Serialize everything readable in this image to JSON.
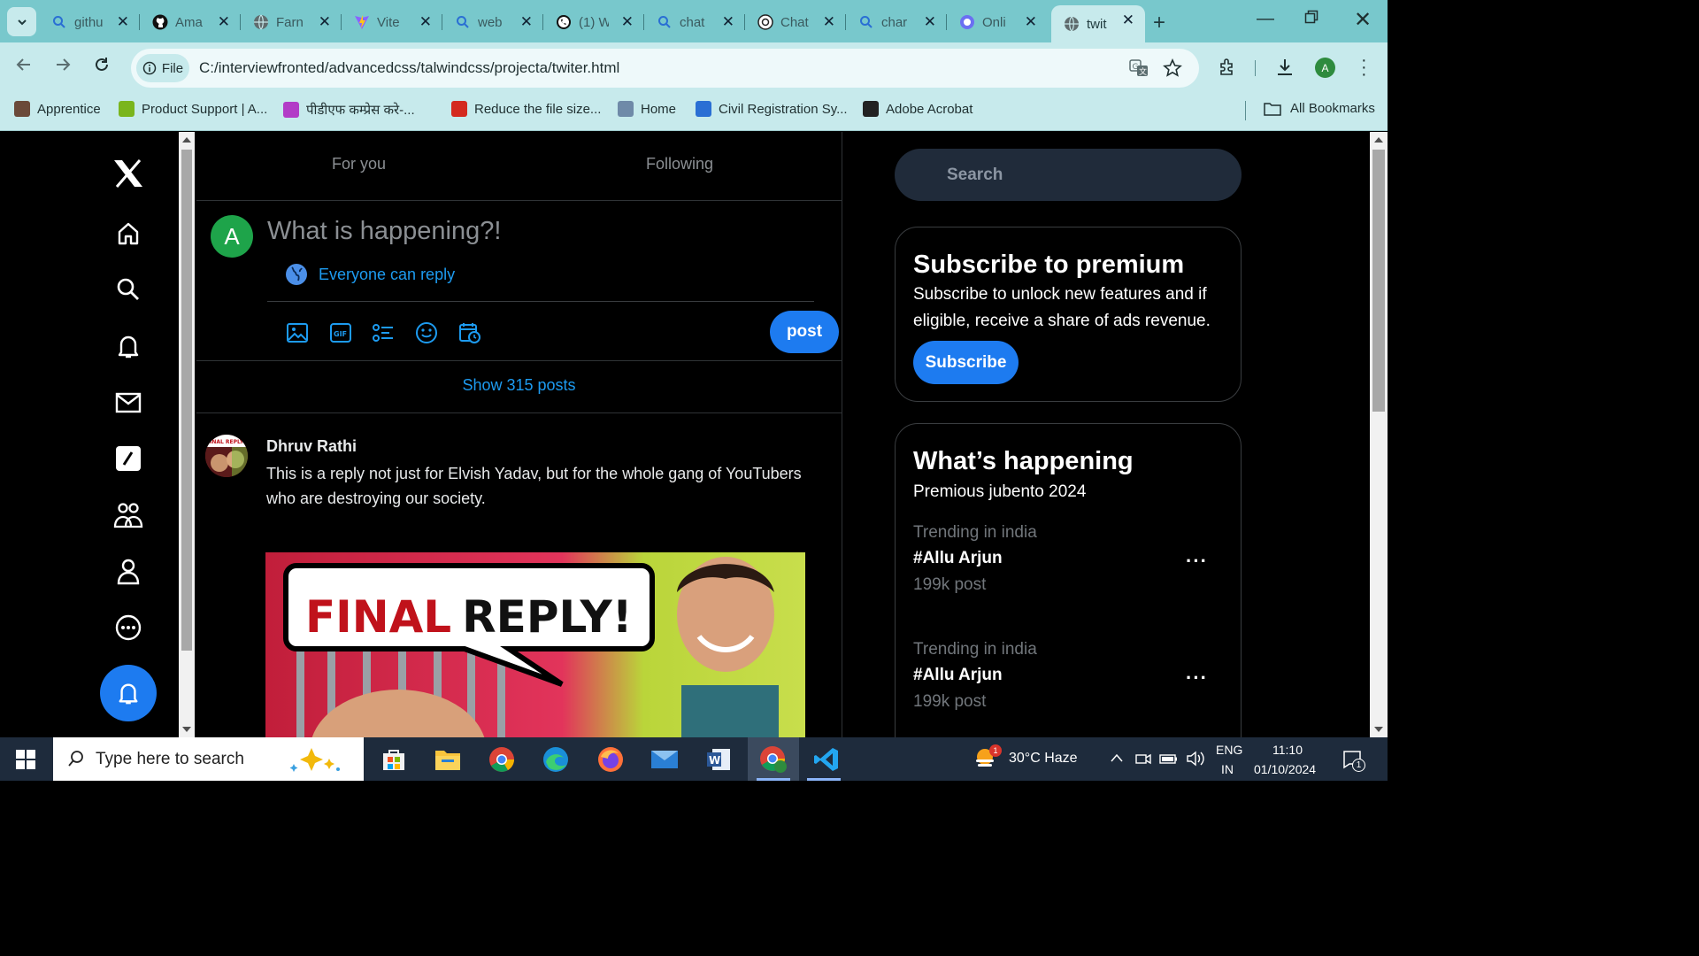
{
  "browser": {
    "tabs": [
      {
        "label": "githu",
        "icon": "search-icon",
        "active": false
      },
      {
        "label": "Ama",
        "icon": "github-icon",
        "active": false
      },
      {
        "label": "Farn",
        "icon": "globe-icon",
        "active": false
      },
      {
        "label": "Vite",
        "icon": "vite-icon",
        "active": false
      },
      {
        "label": "web",
        "icon": "search-icon",
        "active": false
      },
      {
        "label": "(1) W",
        "icon": "whatsapp-icon",
        "active": false
      },
      {
        "label": "chat",
        "icon": "search-icon",
        "active": false
      },
      {
        "label": "Chat",
        "icon": "openai-icon",
        "active": false
      },
      {
        "label": "char",
        "icon": "search-icon",
        "active": false
      },
      {
        "label": "Onli",
        "icon": "online-icon",
        "active": false
      },
      {
        "label": "twit",
        "icon": "globe-icon",
        "active": true
      }
    ],
    "file_chip": "File",
    "url": "C:/interviewfronted/advancedcss/talwindcss/projecta/twiter.html",
    "profile_initial": "A",
    "bookmarks": [
      {
        "label": "Apprentice",
        "color": "#6b4a3a"
      },
      {
        "label": "Product Support | A...",
        "color": "#7ab51d"
      },
      {
        "label": "पीडीएफ कम्प्रेस करे-...",
        "color": "#b23cc7"
      },
      {
        "label": "Reduce the file size...",
        "color": "#d42a1f"
      },
      {
        "label": "Home",
        "color": "#6f8aa8"
      },
      {
        "label": "Civil Registration Sy...",
        "color": "#2a6fd4"
      },
      {
        "label": "Adobe Acrobat",
        "color": "#222222"
      }
    ],
    "all_bookmarks": "All Bookmarks"
  },
  "sidebar": {
    "items": [
      "x-logo-icon",
      "home-icon",
      "search-icon",
      "bell-icon",
      "mail-icon",
      "grok-icon",
      "communities-icon",
      "profile-icon",
      "more-icon"
    ],
    "fab_icon": "bell-icon",
    "accent": "#1d7bf0"
  },
  "main": {
    "tabs": [
      "For you",
      "Following"
    ],
    "composer": {
      "avatar_initial": "A",
      "placeholder": "What is happening?!",
      "reply_setting": "Everyone can reply",
      "tools": [
        "image-icon",
        "gif-icon",
        "poll-icon",
        "emoji-icon",
        "schedule-icon"
      ],
      "post_label": "post"
    },
    "show_posts": "Show 315 posts",
    "post": {
      "author": "Dhruv Rathi",
      "text": "This is a reply not just for Elvish Yadav, but for the whole gang of YouTubers who are destroying our society.",
      "image_text": "FINAL REPLY!",
      "avatar_badge": "FINAL REPLY!"
    }
  },
  "right": {
    "search_placeholder": "Search",
    "premium": {
      "title": "Subscribe to premium",
      "text": "Subscribe to unlock new features and if eligible, receive a share of ads revenue.",
      "button": "Subscribe"
    },
    "happening": {
      "title": "What’s happening",
      "subtitle": "Premious jubento 2024",
      "trends": [
        {
          "meta": "Trending in india",
          "tag": "#Allu Arjun",
          "count": "199k post",
          "more": "···"
        },
        {
          "meta": "Trending in india",
          "tag": "#Allu Arjun",
          "count": "199k post",
          "more": "···"
        }
      ]
    }
  },
  "taskbar": {
    "search_placeholder": "Type here to search",
    "weather": "30°C  Haze",
    "weather_badge": "1",
    "lang_top": "ENG",
    "lang_bottom": "IN",
    "time": "11:10",
    "date": "01/10/2024",
    "notif_count": "1"
  }
}
